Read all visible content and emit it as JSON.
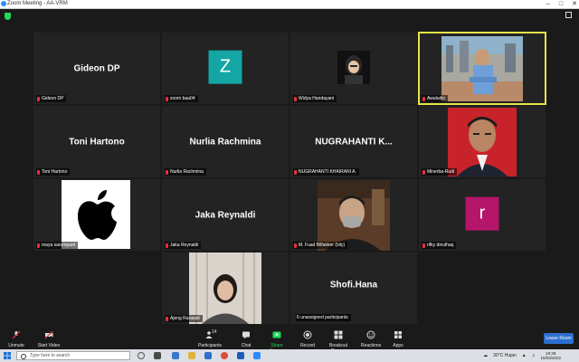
{
  "window": {
    "title": "Zoom Meeting - AA-VRM"
  },
  "tiles": [
    {
      "name": "Gideon DP",
      "label": "Gideon DP"
    },
    {
      "letter": "Z",
      "label": "zoom baa04",
      "color": "#14a6a4"
    },
    {
      "label": "Widya Handayani"
    },
    {
      "label": "Awaludin"
    },
    {
      "name": "Toni Hartono",
      "label": "Toni Hartono"
    },
    {
      "name": "Nurlia Rachmina",
      "label": "Nurlia Rachmina"
    },
    {
      "name": "NUGRAHANTI K...",
      "label": "NUGRAHANTI KHAIRANI A."
    },
    {
      "label": "Minerba-Rudi"
    },
    {
      "label": "maya sarumpaet"
    },
    {
      "name": "Jaka Reynaldi",
      "label": "Jaka Reynaldi"
    },
    {
      "label": "M. Fuad Bilfakker (bily)"
    },
    {
      "letter": "r",
      "label": "rifky dinulhaq",
      "color": "#b5166a"
    },
    {
      "label": "Ajeng Rarasati"
    },
    {
      "name": "Shofi.Hana",
      "label": "6 unassigned participants"
    }
  ],
  "toolbar": {
    "unmute": "Unmute",
    "start_video": "Start Video",
    "participants": "Participants",
    "participants_count": "14",
    "chat": "Chat",
    "share_screen": "Share Screen",
    "record": "Record",
    "breakout_rooms": "Breakout Rooms",
    "reactions": "Reactions",
    "apps": "Apps",
    "leave": "Leave Room"
  },
  "taskbar": {
    "search_placeholder": "Type here to search",
    "weather": "30°C  Hujan",
    "time": "18:38",
    "date": "16/03/2022"
  },
  "colors": {
    "active_speaker": "#e8e54a",
    "muted": "#e8303a",
    "share_green": "#23d959",
    "leave_blue": "#2d6fd0"
  }
}
